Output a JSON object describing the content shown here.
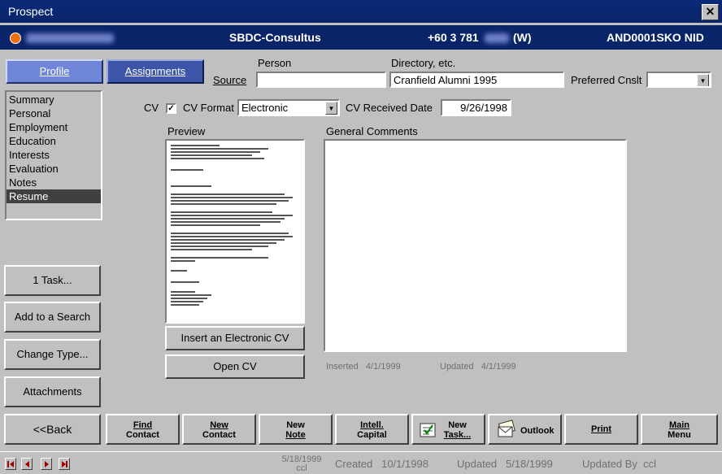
{
  "window": {
    "title": "Prospect",
    "close_label": "✕"
  },
  "header": {
    "phone": "+60 3 781",
    "phone_suffix": "(W)",
    "company": "SBDC-Consultus",
    "code": "AND0001SKO NID"
  },
  "tabs": [
    {
      "label": "Profile"
    },
    {
      "label": "Assignments"
    }
  ],
  "source": {
    "label": "Source",
    "person_label": "Person",
    "person_value": "",
    "directory_label": "Directory, etc.",
    "directory_value": "Cranfield Alumni 1995",
    "preferred_label": "Preferred Cnslt",
    "preferred_value": ""
  },
  "nav": {
    "items": [
      "Summary",
      "Personal",
      "Employment",
      "Education",
      "Interests",
      "Evaluation",
      "Notes",
      "Resume"
    ],
    "selected": "Resume"
  },
  "cv": {
    "label": "CV",
    "checked": true,
    "format_label": "CV Format",
    "format_value": "Electronic",
    "received_label": "CV Received Date",
    "received_value": "9/26/1998",
    "check_glyph": "✓"
  },
  "preview": {
    "label": "Preview"
  },
  "comments": {
    "label": "General Comments",
    "value": ""
  },
  "cv_buttons": {
    "insert": "Insert an Electronic CV",
    "open": "Open CV"
  },
  "meta": {
    "inserted": "Inserted   4/1/1999",
    "updated": "Updated   4/1/1999"
  },
  "side_buttons": {
    "task": "1 Task...",
    "search": "Add to a Search",
    "change_type": "Change Type...",
    "attachments": "Attachments",
    "back": "<<Back"
  },
  "footer": {
    "find1": "Find",
    "find2": "Contact",
    "newc1": "New",
    "newc2": "Contact",
    "newn1": "New",
    "newn2": "Note",
    "intel1": "Intell.",
    "intel2": "Capital",
    "newt1": "New",
    "newt2": "Task...",
    "outlook": "Outlook",
    "print": "Print",
    "main1": "Main",
    "main2": "Menu"
  },
  "status": {
    "date": "5/18/1999",
    "user": "ccl",
    "created": "Created   10/1/1998",
    "updated": "Updated   5/18/1999",
    "updated_by": "Updated By  ccl"
  }
}
